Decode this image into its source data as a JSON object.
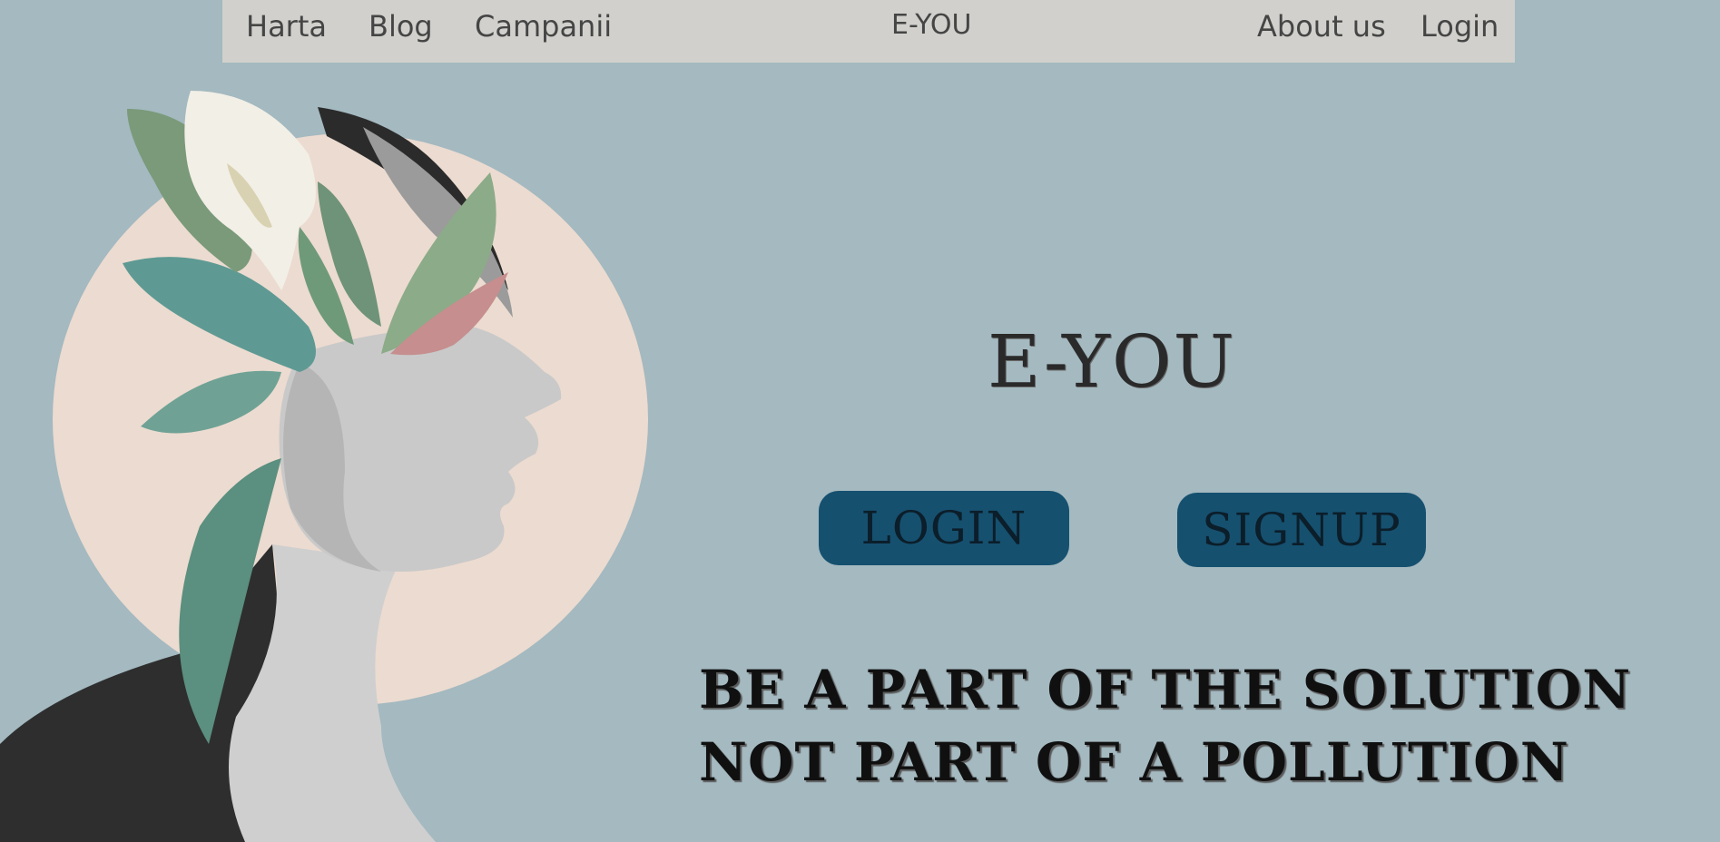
{
  "nav": {
    "links_left": [
      "Harta",
      "Blog",
      "Campanii"
    ],
    "brand": "E-YOU",
    "links_right": [
      "About us",
      "Login"
    ]
  },
  "hero": {
    "title": "E-YOU",
    "login_button": "LOGIN",
    "signup_button": "SIGNUP",
    "slogan_line1": "BE A PART OF THE SOLUTION",
    "slogan_line2": "NOT PART OF A POLLUTION"
  },
  "colors": {
    "page_background": "#a4b9c0",
    "nav_background": "#d1d0cc",
    "button_background": "#16506f",
    "circle_fill": "#ecdbd0"
  }
}
